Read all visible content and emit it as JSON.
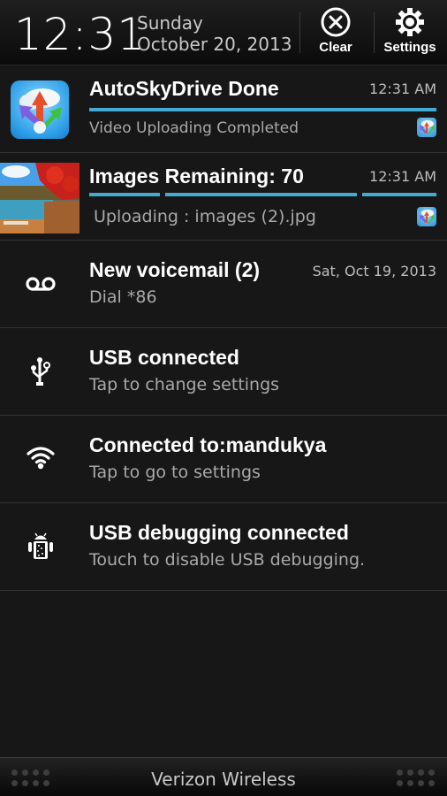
{
  "header": {
    "time": "12:31",
    "day": "Sunday",
    "date": "October 20, 2013",
    "clear_label": "Clear",
    "clear_icon": "close-circle-icon",
    "settings_label": "Settings",
    "settings_icon": "gear-icon"
  },
  "notifications": [
    {
      "icon": "autoskydrive-app-icon",
      "title": "AutoSkyDrive Done",
      "subtitle": "Video Uploading Completed",
      "time": "12:31 AM",
      "progress_percent": 100,
      "small_icon": "autoskydrive-small-icon"
    },
    {
      "icon": "autumn-lake-thumbnail",
      "title": "Images Remaining: 70",
      "subtitle": "Uploading : images (2).jpg",
      "time": "12:31 AM",
      "progress": "indeterminate",
      "small_icon": "autoskydrive-small-icon"
    },
    {
      "icon": "voicemail-icon",
      "title": "New voicemail (2)",
      "subtitle": "Dial *86",
      "time": "Sat, Oct 19, 2013"
    },
    {
      "icon": "usb-icon",
      "title": "USB connected",
      "subtitle": "Tap to change settings"
    },
    {
      "icon": "wifi-icon",
      "title": "Connected to:mandukya",
      "subtitle": "Tap to go to settings"
    },
    {
      "icon": "android-debug-icon",
      "title": "USB debugging connected",
      "subtitle": "Touch to disable USB debugging."
    }
  ],
  "footer": {
    "carrier": "Verizon Wireless"
  },
  "colors": {
    "accent": "#44a9d3",
    "background": "#171717"
  }
}
